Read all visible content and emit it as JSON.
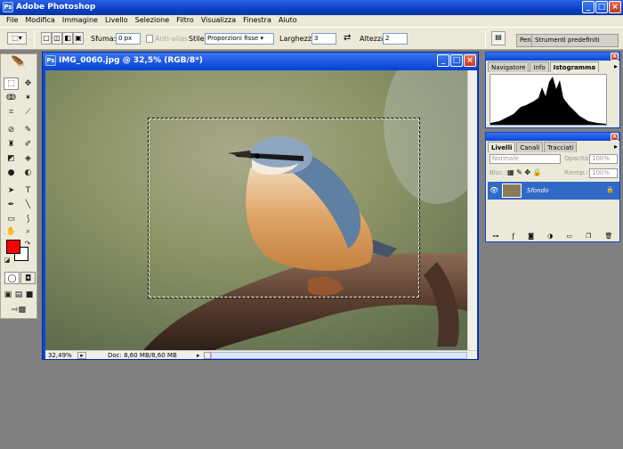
{
  "app": {
    "title": "Adobe Photoshop",
    "logo": "Ps"
  },
  "window_buttons": {
    "minimize": "_",
    "maximize": "□",
    "close": "×"
  },
  "menu": [
    "File",
    "Modifica",
    "Immagine",
    "Livello",
    "Selezione",
    "Filtro",
    "Visualizza",
    "Finestra",
    "Aiuto"
  ],
  "options": {
    "sfuma_label": "Sfuma:",
    "sfuma_value": "0 px",
    "antialias_label": "Anti-alias",
    "stile_label": "Stile:",
    "stile_value": "Proporzioni fisse",
    "larghezza_label": "Larghezza:",
    "larghezza_value": "3",
    "altezza_label": "Altezza:",
    "altezza_value": "2",
    "presets_tab": "Pen",
    "presets_label": "Strumenti predefiniti"
  },
  "document": {
    "title": "IMG_0060.jpg @ 32,5% (RGB/8*)",
    "zoom": "32,49%",
    "doc_info": "Doc: 8,60 MB/8,60 MB"
  },
  "navigator": {
    "tabs": [
      "Navigatore",
      "Info",
      "Istogramma"
    ],
    "active": 2
  },
  "layers": {
    "tabs": [
      "Livelli",
      "Canali",
      "Tracciati"
    ],
    "blend_mode": "Normale",
    "opacity_label": "Opacità:",
    "opacity_value": "100%",
    "lock_label": "Bloc.:",
    "fill_label": "Riemp.:",
    "fill_value": "100%",
    "layer_name": "Sfondo"
  },
  "colors": {
    "foreground": "#ff0000",
    "background": "#ffffff",
    "titlebar": "#0a46d8"
  }
}
